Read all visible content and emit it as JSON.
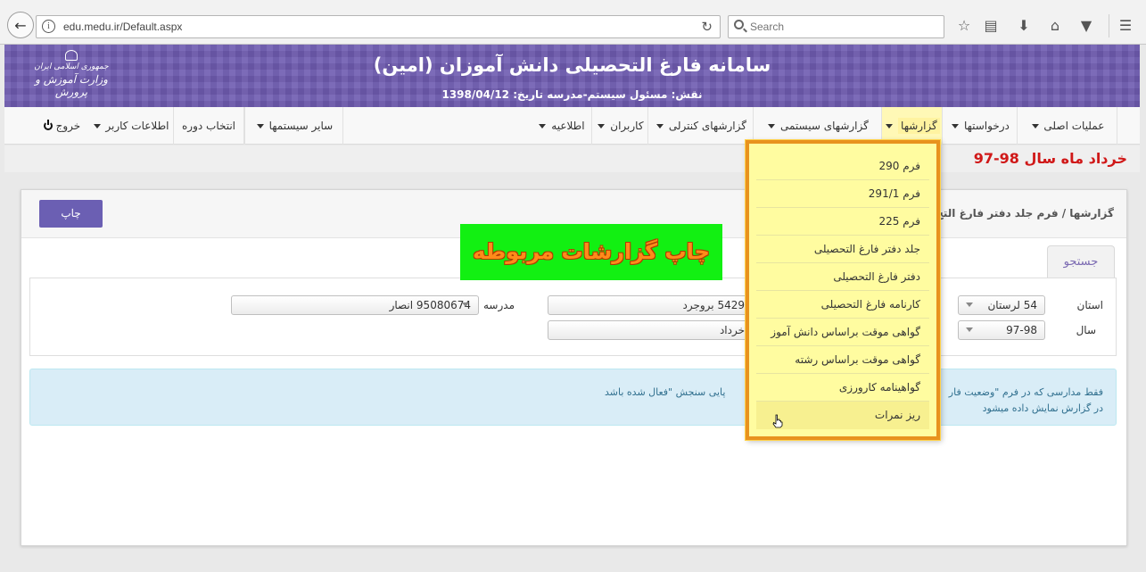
{
  "browser": {
    "url": "edu.medu.ir/Default.aspx",
    "search_placeholder": "Search"
  },
  "header": {
    "title": "سامانه فارغ التحصیلی دانش آموزان (امین)",
    "subtitle": "نقش: مسئول سیستم-مدرسه   تاریخ: 1398/04/12",
    "ministry_line1": "جمهوری اسلامی ایران",
    "ministry_line2": "وزارت آموزش و پرورش"
  },
  "nav": {
    "items": [
      {
        "label": "عملیات اصلی",
        "has_caret": true
      },
      {
        "label": "درخواستها",
        "has_caret": true
      },
      {
        "label": "گزارشها",
        "has_caret": true,
        "active": true
      },
      {
        "label": "گزارشهای سیستمی",
        "has_caret": true
      },
      {
        "label": "گزارشهای کنترلی",
        "has_caret": true
      },
      {
        "label": "کاربران",
        "has_caret": true
      },
      {
        "label": "اطلاعیه",
        "has_caret": true
      },
      {
        "label": "سایر سیستمها",
        "has_caret": true
      },
      {
        "label": "انتخاب دوره",
        "has_caret": false
      },
      {
        "label": "اطلاعات کاربر",
        "has_caret": true
      },
      {
        "label": "خروج",
        "has_caret": false
      }
    ]
  },
  "date_banner": "خرداد ماه سال 98-97",
  "panel": {
    "print_label": "چاپ",
    "breadcrumb": "گزارشها / فرم جلد دفتر فارغ التح",
    "search_tab": "جستجو",
    "fields": {
      "province_label": "استان",
      "province_value": "54 لرستان",
      "year_label": "سال",
      "year_value": "97-98",
      "city_value": "5429 بروجرد",
      "month_value": "خرداد",
      "school_label": "مدرسه",
      "school_value": "95080674 انصار"
    },
    "info_line1_right": "فقط مدارسی که در فرم \"وضعیت فار",
    "info_line1_left": "پایی سنجش \"فعال شده باشد",
    "info_line2": "در گزارش نمایش داده میشود"
  },
  "banner_text": "چاپ گزارشات مربوطه",
  "dropdown": {
    "items": [
      "فرم 290",
      "فرم 291/1",
      "فرم 225",
      "جلد دفتر فارغ التحصیلی",
      "دفتر فارغ التحصیلی",
      "کارنامه فارغ التحصیلی",
      "گواهی موقت براساس دانش آموز",
      "گواهی موقت براساس رشته",
      "گواهینامه کارورزی",
      "ریز نمرات"
    ]
  },
  "colors": {
    "header_purple": "#6e5bb0",
    "date_red": "#d01818",
    "dropdown_yellow": "#fffca0",
    "dropdown_border": "#e8921e",
    "banner_green": "#12f012",
    "banner_text": "#ff8b1a",
    "info_bg": "#d9edf7"
  }
}
